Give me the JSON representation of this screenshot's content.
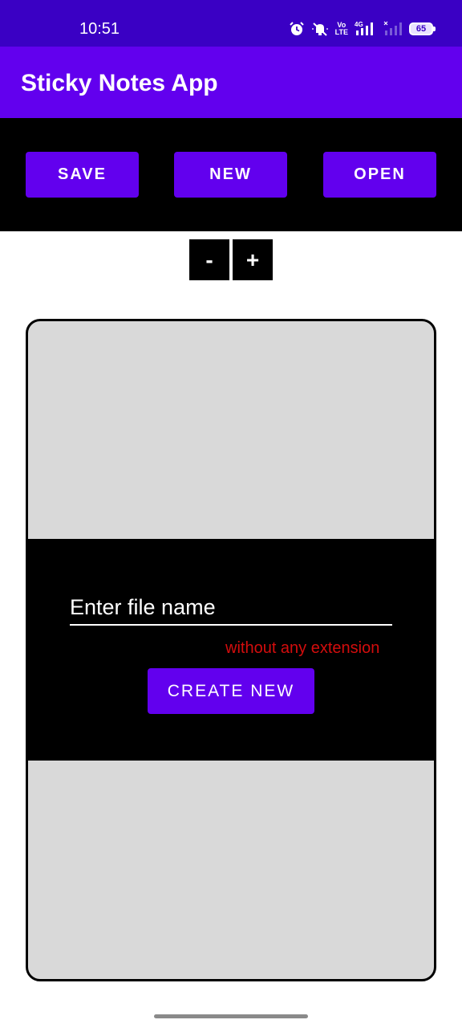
{
  "status_bar": {
    "time": "10:51",
    "icons": [
      "alarm-icon",
      "mute-icon",
      "volte-icon",
      "signal-icon",
      "signal-weak-icon"
    ],
    "volte_label": "Vo\nLTE",
    "network_label": "4G",
    "battery_level": "65"
  },
  "app_bar": {
    "title": "Sticky Notes App"
  },
  "toolbar": {
    "save_label": "SAVE",
    "new_label": "NEW",
    "open_label": "OPEN"
  },
  "zoom": {
    "minus_label": "-",
    "plus_label": "+"
  },
  "dialog": {
    "file_name_placeholder": "Enter file name",
    "file_name_value": "",
    "hint": "without any extension",
    "create_label": "CREATE NEW"
  },
  "colors": {
    "status_bar": "#3a00c4",
    "primary": "#6200ee",
    "note_background": "#d9d9d9",
    "hint_text": "#d30d0d"
  }
}
